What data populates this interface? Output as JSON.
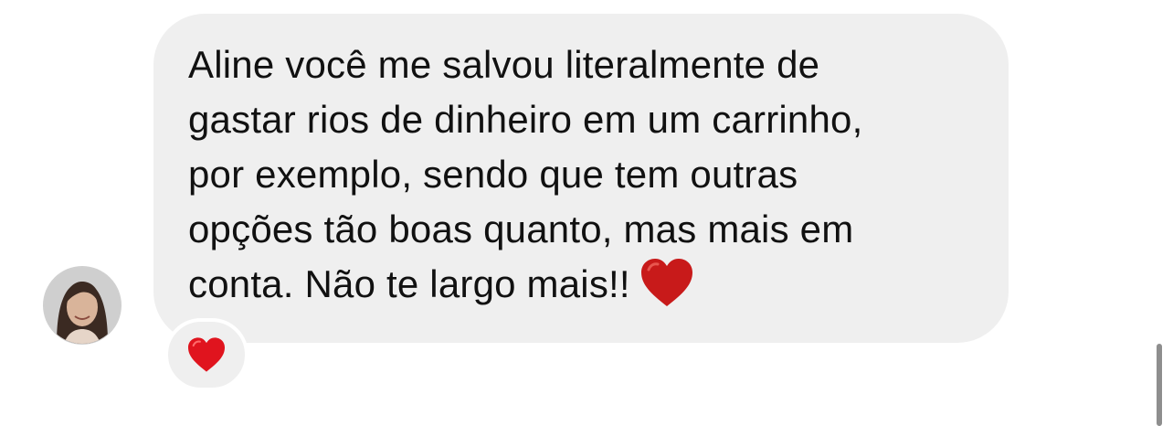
{
  "message": {
    "lines": [
      "Aline você me salvou literalmente de",
      "gastar rios de dinheiro em um carrinho,",
      "por exemplo, sendo que tem outras",
      "opções tão boas quanto, mas mais em",
      "conta. Não te largo mais!!"
    ],
    "trailing_emoji": "heart-icon"
  },
  "reaction": {
    "icon": "heart-icon",
    "color": "#e0141e"
  },
  "colors": {
    "bubble": "#efefef",
    "text": "#111111",
    "inline_heart": "#c81a1a",
    "scrollbar": "#8e8e8e"
  }
}
